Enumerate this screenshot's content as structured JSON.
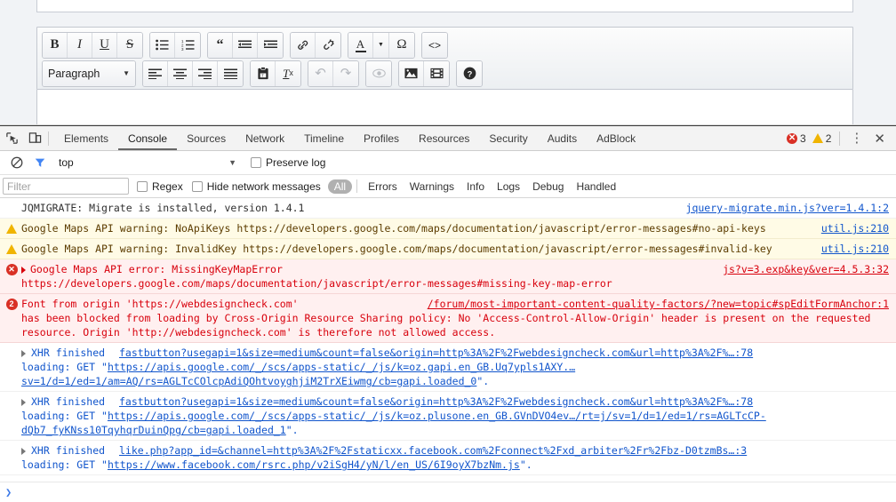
{
  "editor": {
    "toolbar_row1": [
      {
        "group": [
          {
            "name": "bold-button",
            "glyph": "B",
            "style": "bold"
          },
          {
            "name": "italic-button",
            "glyph": "I",
            "style": "italic"
          },
          {
            "name": "underline-button",
            "glyph": "U",
            "style": "underline"
          },
          {
            "name": "strikethrough-button",
            "glyph": "S",
            "style": "strike"
          }
        ]
      },
      {
        "group": [
          {
            "name": "unordered-list-button",
            "glyph": "☰",
            "style": "ul"
          },
          {
            "name": "ordered-list-button",
            "glyph": "☰",
            "style": "ol"
          }
        ]
      },
      {
        "group": [
          {
            "name": "blockquote-button",
            "glyph": "❝",
            "style": "quote"
          },
          {
            "name": "outdent-button",
            "glyph": "☰",
            "style": "outdent"
          },
          {
            "name": "indent-button",
            "glyph": "☰",
            "style": "indent"
          }
        ]
      },
      {
        "group": [
          {
            "name": "insert-link-button",
            "glyph": "🔗",
            "style": "link"
          },
          {
            "name": "unlink-button",
            "glyph": "🔗",
            "style": "unlink"
          }
        ]
      },
      {
        "group": [
          {
            "name": "text-color-button",
            "glyph": "A",
            "style": "color"
          },
          {
            "name": "text-color-dropdown",
            "glyph": "▼",
            "style": "caret"
          },
          {
            "name": "special-character-button",
            "glyph": "Ω",
            "style": "omega"
          }
        ]
      },
      {
        "group": [
          {
            "name": "source-code-button",
            "glyph": "<>",
            "style": "code"
          }
        ]
      }
    ],
    "toolbar_row2": [
      {
        "group": [
          {
            "name": "paragraph-format-select",
            "glyph": "Paragraph",
            "style": "select"
          }
        ]
      },
      {
        "group": [
          {
            "name": "align-left-button",
            "glyph": "☰",
            "style": "al"
          },
          {
            "name": "align-center-button",
            "glyph": "☰",
            "style": "ac"
          },
          {
            "name": "align-right-button",
            "glyph": "☰",
            "style": "ar"
          },
          {
            "name": "align-justify-button",
            "glyph": "☰",
            "style": "aj"
          }
        ]
      },
      {
        "group": [
          {
            "name": "paste-as-text-button",
            "glyph": "📋",
            "style": "paste"
          },
          {
            "name": "remove-format-button",
            "glyph": "Tx",
            "style": "removefmt"
          }
        ]
      },
      {
        "group": [
          {
            "name": "undo-button",
            "glyph": "↶",
            "style": "undo",
            "disabled": true
          },
          {
            "name": "redo-button",
            "glyph": "↷",
            "style": "redo",
            "disabled": true
          }
        ]
      },
      {
        "group": [
          {
            "name": "preview-button",
            "glyph": "👁",
            "style": "eye",
            "disabled": true
          }
        ]
      },
      {
        "group": [
          {
            "name": "insert-image-button",
            "glyph": "🖼",
            "style": "image"
          },
          {
            "name": "insert-media-button",
            "glyph": "🎞",
            "style": "media"
          }
        ]
      },
      {
        "group": [
          {
            "name": "help-button",
            "glyph": "?",
            "style": "help"
          }
        ]
      }
    ],
    "paragraph_label": "Paragraph"
  },
  "devtools": {
    "tabs": [
      {
        "label": "Elements",
        "active": false
      },
      {
        "label": "Console",
        "active": true
      },
      {
        "label": "Sources",
        "active": false
      },
      {
        "label": "Network",
        "active": false
      },
      {
        "label": "Timeline",
        "active": false
      },
      {
        "label": "Profiles",
        "active": false
      },
      {
        "label": "Resources",
        "active": false
      },
      {
        "label": "Security",
        "active": false
      },
      {
        "label": "Audits",
        "active": false
      },
      {
        "label": "AdBlock",
        "active": false
      }
    ],
    "error_count": "3",
    "warning_count": "2",
    "icons": {
      "inspect": "inspect-element-icon",
      "device": "device-toolbar-icon",
      "kebab": "⋮",
      "close": "✕",
      "clear_console": "clear-console-icon",
      "filter": "filter-funnel-icon"
    },
    "context": {
      "selected": "top",
      "caret": "▼"
    },
    "preserve_log": {
      "label": "Preserve log",
      "checked": false
    },
    "filter": {
      "placeholder": "Filter",
      "value": "",
      "regex_label": "Regex",
      "regex_checked": false,
      "hide_network_label": "Hide network messages",
      "hide_network_checked": false,
      "levels": [
        {
          "label": "All",
          "active": true
        },
        {
          "label": "Errors",
          "active": false
        },
        {
          "label": "Warnings",
          "active": false
        },
        {
          "label": "Info",
          "active": false
        },
        {
          "label": "Logs",
          "active": false
        },
        {
          "label": "Debug",
          "active": false
        },
        {
          "label": "Handled",
          "active": false
        }
      ]
    },
    "prompt": {
      "chevron": "❯",
      "value": ""
    },
    "messages": [
      {
        "type": "log",
        "icon": "none",
        "text": "JQMIGRATE: Migrate is installed, version 1.4.1",
        "source": "jquery-migrate.min.js?ver=1.4.1:2"
      },
      {
        "type": "warn",
        "icon": "warning-triangle-icon",
        "text": "Google Maps API warning: NoApiKeys https://developers.google.com/maps/documentation/javascript/error-messages#no-api-keys",
        "source": "util.js:210"
      },
      {
        "type": "warn",
        "icon": "warning-triangle-icon",
        "text": "Google Maps API warning: InvalidKey https://developers.google.com/maps/documentation/javascript/error-messages#invalid-key",
        "source": "util.js:210"
      },
      {
        "type": "err",
        "icon": "error-circle-icon",
        "expandable": true,
        "text": "Google Maps API error: MissingKeyMapError",
        "text2": "https://developers.google.com/maps/documentation/javascript/error-messages#missing-key-map-error",
        "source": "js?v=3.exp&key&ver=4.5.3:32"
      },
      {
        "type": "err",
        "icon": "error-count-icon",
        "count": "2",
        "text": "Font from origin 'https://webdesigncheck.com'",
        "text2": "has been blocked from loading by Cross-Origin Resource Sharing policy: No 'Access-Control-Allow-Origin' header is present on the requested resource. Origin 'http://webdesigncheck.com' is therefore not allowed access.",
        "source": "/forum/most-important-content-quality-factors/?new=topic#spEditFormAnchor:1"
      },
      {
        "type": "xhr",
        "icon": "none",
        "expandable": true,
        "label": "XHR finished",
        "source": "fastbutton?usegapi=1&size=medium&count=false&origin=http%3A%2F%2Fwebdesigncheck.com&url=http%3A%2F%…:78",
        "detail_prefix": "loading: GET \"",
        "detail_link": "https://apis.google.com/_/scs/apps-static/_/js/k=oz.gapi.en_GB.Uq7ypls1AXY.…\nsv=1/d=1/ed=1/am=AQ/rs=AGLTcCOlcpAdiQOhtvoyghjiM2TrXEiwmg/cb=gapi.loaded_0",
        "detail_suffix": "\"."
      },
      {
        "type": "xhr",
        "icon": "none",
        "expandable": true,
        "label": "XHR finished",
        "source": "fastbutton?usegapi=1&size=medium&count=false&origin=http%3A%2F%2Fwebdesigncheck.com&url=http%3A%2F%…:78",
        "detail_prefix": "loading: GET \"",
        "detail_link": "https://apis.google.com/_/scs/apps-static/_/js/k=oz.plusone.en_GB.GVnDVO4ev…/rt=j/sv=1/d=1/ed=1/rs=AGLTcCP-\ndQb7_fyKNss10TqyhqrDuinQpg/cb=gapi.loaded_1",
        "detail_suffix": "\"."
      },
      {
        "type": "xhr",
        "icon": "none",
        "expandable": true,
        "label": "XHR finished",
        "source": "like.php?app_id=&channel=http%3A%2F%2Fstaticxx.facebook.com%2Fconnect%2Fxd_arbiter%2Fr%2Fbz-D0tzmBs…:3",
        "detail_prefix": "loading: GET \"",
        "detail_link": "https://www.facebook.com/rsrc.php/v2iSgH4/yN/l/en_US/6I9oyX7bzNm.js",
        "detail_suffix": "\"."
      }
    ]
  },
  "colors": {
    "error_red": "#d8000c",
    "error_bg": "#fff0f0",
    "warn_bg": "#fffbe6",
    "warn_yellow": "#f0b400",
    "link_blue": "#1155cc",
    "prompt_blue": "#3b78e7"
  }
}
